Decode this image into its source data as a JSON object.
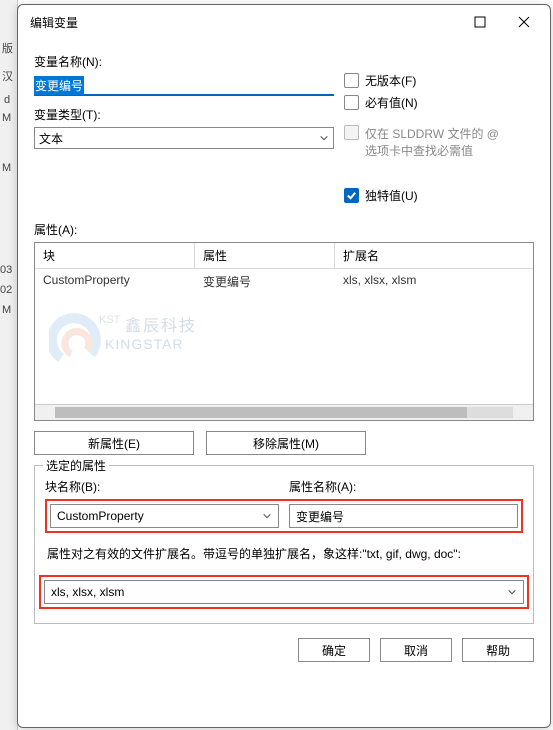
{
  "window": {
    "title": "编辑变量"
  },
  "left_bg": [
    "版",
    "汉",
    "d",
    "M",
    "M",
    "03",
    "02",
    "M"
  ],
  "var_name": {
    "label": "变量名称(N):",
    "value": "变更编号"
  },
  "var_type": {
    "label": "变量类型(T):",
    "value": "文本"
  },
  "checks": {
    "no_version": "无版本(F)",
    "must_have": "必有值(N)",
    "only_slddrw_l1": "仅在 SLDDRW 文件的 @",
    "only_slddrw_l2": "选项卡中查找必需值",
    "unique": "独特值(U)"
  },
  "attr_label": "属性(A):",
  "table": {
    "headers": [
      "块",
      "属性",
      "扩展名"
    ],
    "rows": [
      {
        "block": "CustomProperty",
        "attr": "变更编号",
        "ext": "xls, xlsx, xlsm"
      }
    ]
  },
  "watermark": {
    "line1": "鑫辰科技",
    "line2": "KINGSTAR",
    "kst": "KST"
  },
  "buttons": {
    "new_attr": "新属性(E)",
    "remove_attr": "移除属性(M)"
  },
  "group": {
    "legend": "选定的属性",
    "block_label": "块名称(B):",
    "block_value": "CustomProperty",
    "attr_label": "属性名称(A):",
    "attr_value": "变更编号",
    "hint": "属性对之有效的文件扩展名。带逗号的单独扩展名，象这样:\"txt, gif, dwg, doc\":",
    "ext_value": "xls, xlsx, xlsm"
  },
  "footer": {
    "ok": "确定",
    "cancel": "取消",
    "help": "帮助"
  }
}
